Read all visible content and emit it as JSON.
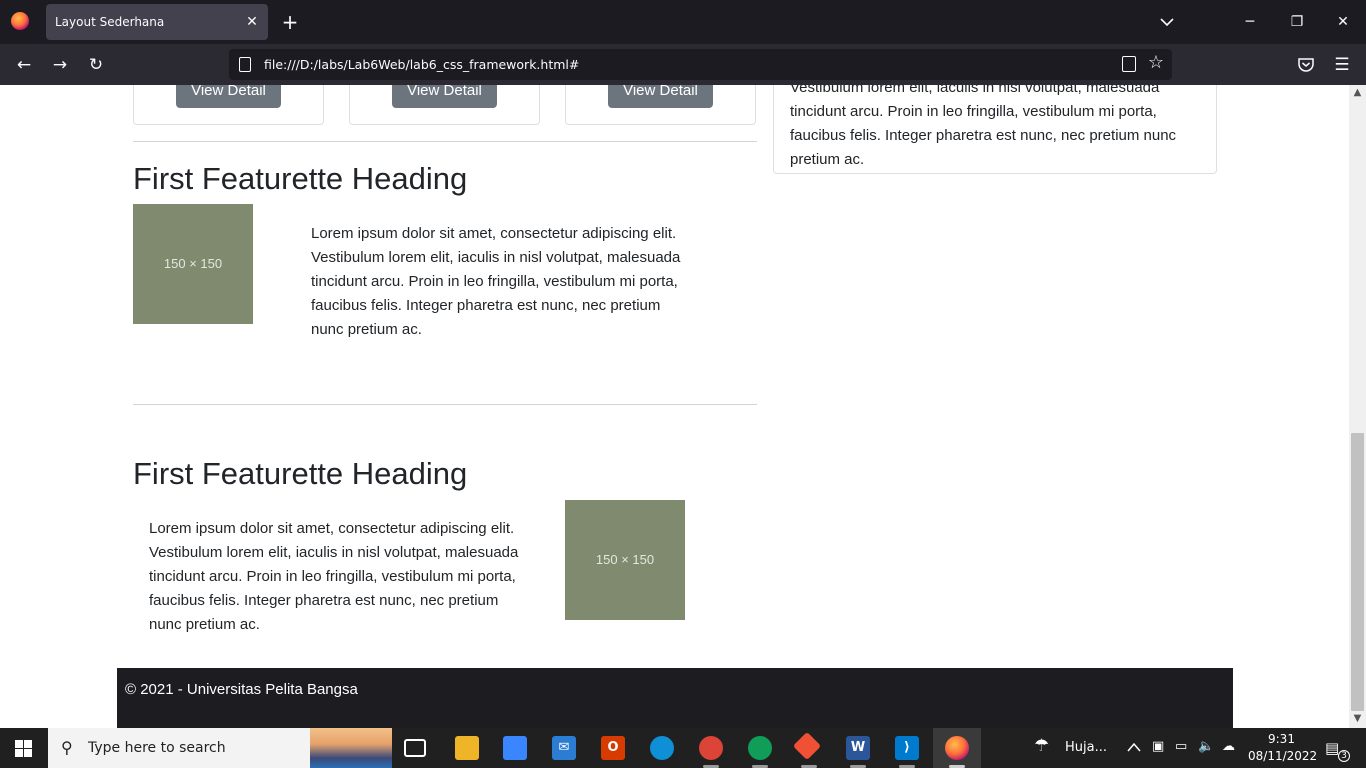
{
  "browser": {
    "tab_title": "Layout Sederhana",
    "url": "file:///D:/labs/Lab6Web/lab6_css_framework.html#"
  },
  "page": {
    "cards": [
      {
        "button_label": "View Detail"
      },
      {
        "button_label": "View Detail"
      },
      {
        "button_label": "View Detail"
      }
    ],
    "sidebar_text": "Vestibulum lorem elit, iaculis in nisl volutpat, malesuada tincidunt arcu. Proin in leo fringilla, vestibulum mi porta, faucibus felis. Integer pharetra est nunc, nec pretium nunc pretium ac.",
    "featurettes": [
      {
        "heading": "First Featurette Heading",
        "image_label": "150 × 150",
        "text": "Lorem ipsum dolor sit amet, consectetur adipiscing elit. Vestibulum lorem elit, iaculis in nisl volutpat, malesuada tincidunt arcu. Proin in leo fringilla, vestibulum mi porta, faucibus felis. Integer pharetra est nunc, nec pretium nunc pretium ac."
      },
      {
        "heading": "First Featurette Heading",
        "image_label": "150 × 150",
        "text": "Lorem ipsum dolor sit amet, consectetur adipiscing elit. Vestibulum lorem elit, iaculis in nisl volutpat, malesuada tincidunt arcu. Proin in leo fringilla, vestibulum mi porta, faucibus felis. Integer pharetra est nunc, nec pretium nunc pretium ac."
      }
    ],
    "footer_text": "© 2021 - Universitas Pelita Bangsa"
  },
  "taskbar": {
    "search_placeholder": "Type here to search",
    "weather_label": "Huja...",
    "time": "9:31",
    "date": "08/11/2022",
    "notification_count": "3"
  },
  "colors": {
    "tabbar_bg": "#1c1b22",
    "navbar_bg": "#2b2a33",
    "button_bg": "#6c757d",
    "placeholder_bg": "#7f8a6f",
    "footer_bg": "#1c1c21",
    "taskbar_bg": "#202020"
  }
}
